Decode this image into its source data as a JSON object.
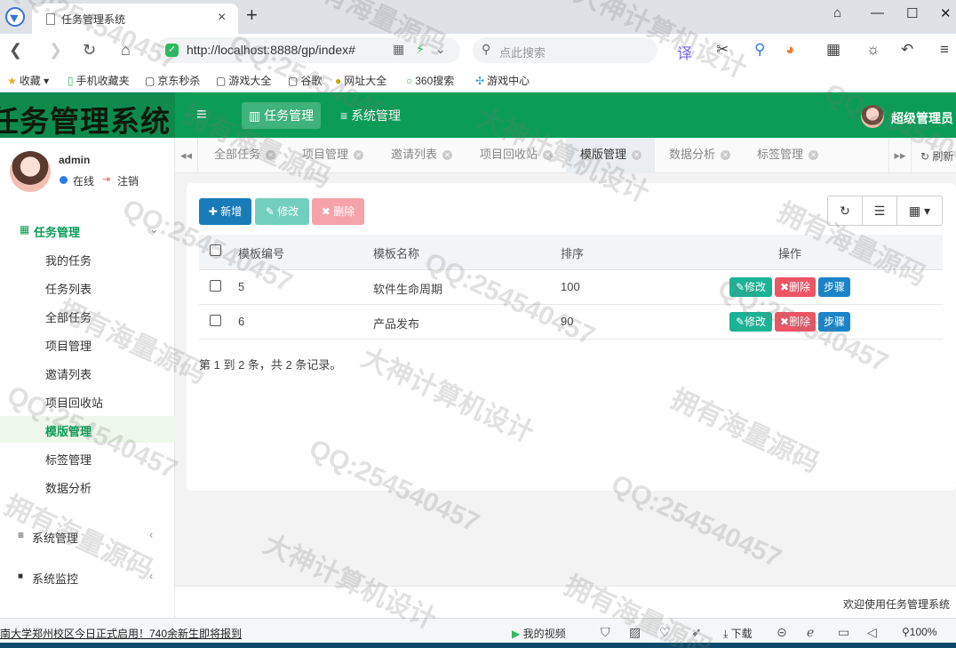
{
  "browser": {
    "tab_title": "任务管理系统",
    "tab_close": "×",
    "new_tab": "+",
    "url": "http://localhost:8888/gp/index#",
    "search_placeholder": "点此搜索",
    "window": {
      "minimize": "—",
      "maximize": "☐",
      "close": "✕",
      "skin": "⌂"
    }
  },
  "bookmarks": [
    {
      "label": "收藏",
      "icon": "★"
    },
    {
      "label": "手机收藏夹",
      "icon": "▯"
    },
    {
      "label": "京东秒杀",
      "icon": "▢"
    },
    {
      "label": "游戏大全",
      "icon": "▢"
    },
    {
      "label": "谷歌",
      "icon": "▢"
    },
    {
      "label": "网址大全",
      "icon": "●"
    },
    {
      "label": "360搜索",
      "icon": "○"
    },
    {
      "label": "游戏中心",
      "icon": "✣"
    }
  ],
  "header": {
    "logo": "任务管理系统",
    "menu": [
      {
        "label": "任务管理",
        "icon": "📊",
        "active": true
      },
      {
        "label": "系统管理",
        "icon": "≡",
        "active": false
      }
    ],
    "user": "超级管理员"
  },
  "sidebar": {
    "username": "admin",
    "status": "在线",
    "logout": "注销",
    "groups": [
      {
        "label": "任务管理",
        "icon": "▦",
        "open": true,
        "items": [
          "我的任务",
          "任务列表",
          "全部任务",
          "项目管理",
          "邀请列表",
          "项目回收站",
          "模版管理",
          "标签管理",
          "数据分析"
        ]
      },
      {
        "label": "系统管理",
        "icon": "≡",
        "open": false
      },
      {
        "label": "系统监控",
        "icon": "■",
        "open": false
      }
    ],
    "active_item": "模版管理"
  },
  "page_tabs": {
    "tabs": [
      "全部任务",
      "项目管理",
      "邀请列表",
      "项目回收站",
      "模版管理",
      "数据分析",
      "标签管理"
    ],
    "active": "模版管理",
    "refresh": "刷新"
  },
  "toolbar": {
    "add": "新增",
    "edit": "修改",
    "delete": "删除"
  },
  "table": {
    "columns": [
      "模板编号",
      "模板名称",
      "排序",
      "操作"
    ],
    "rows": [
      {
        "id": "5",
        "name": "软件生命周期",
        "sort": "100"
      },
      {
        "id": "6",
        "name": "产品发布",
        "sort": "90"
      }
    ],
    "op_edit": "修改",
    "op_delete": "删除",
    "op_steps": "步骤"
  },
  "pager": {
    "info": "第 1 到 2 条，共 2 条记录。"
  },
  "footer": {
    "text": "欢迎使用任务管理系统"
  },
  "statusbar": {
    "news": "南大学郑州校区今日正式启用！740余新生即将报到",
    "video": "我的视频",
    "download": "下载",
    "zoom": "100%"
  },
  "watermarks": [
    "拥有海量源码",
    "QQ:254540457",
    "大神计算机设计"
  ],
  "colors": {
    "header": "#0b9d57",
    "primary": "#1a7bb9",
    "success": "#1ab394",
    "danger": "#ed5565",
    "info": "#1c84c6"
  }
}
